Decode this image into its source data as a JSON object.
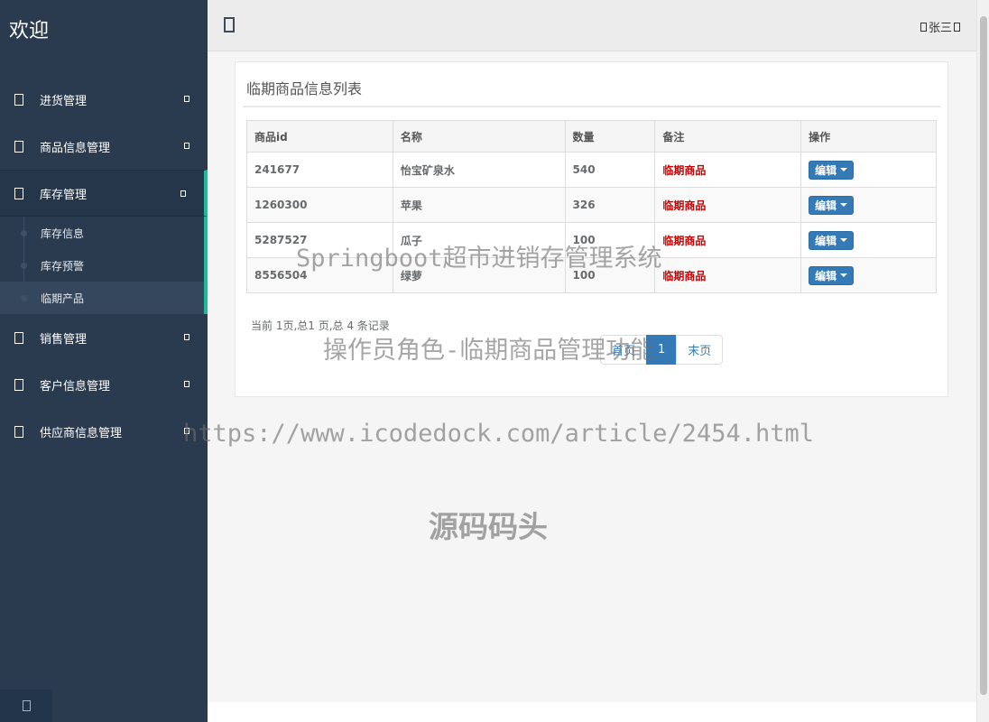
{
  "sidebar": {
    "brand": "欢迎",
    "menu": [
      {
        "label": "进货管理"
      },
      {
        "label": "商品信息管理"
      },
      {
        "label": "库存管理"
      },
      {
        "label": "销售管理"
      },
      {
        "label": "客户信息管理"
      },
      {
        "label": "供应商信息管理"
      }
    ],
    "submenu": [
      {
        "label": "库存信息"
      },
      {
        "label": "库存预警"
      },
      {
        "label": "临期产品"
      }
    ]
  },
  "topbar": {
    "user": "张三"
  },
  "panel": {
    "title": "临期商品信息列表",
    "columns": [
      "商品id",
      "名称",
      "数量",
      "备注",
      "操作"
    ],
    "rows": [
      {
        "id": "241677",
        "name": "怡宝矿泉水",
        "qty": "540",
        "note": "临期商品",
        "action": "编辑"
      },
      {
        "id": "1260300",
        "name": "苹果",
        "qty": "326",
        "note": "临期商品",
        "action": "编辑"
      },
      {
        "id": "5287527",
        "name": "瓜子",
        "qty": "100",
        "note": "临期商品",
        "action": "编辑"
      },
      {
        "id": "8556504",
        "name": "绿萝",
        "qty": "100",
        "note": "临期商品",
        "action": "编辑"
      }
    ],
    "page_info": "当前 1页,总1 页,总 4 条记录",
    "pager": {
      "first": "首页",
      "current": "1",
      "last": "末页"
    }
  },
  "watermarks": {
    "line1": "Springboot超市进销存管理系统",
    "line2": "操作员角色-临期商品管理功能",
    "line3": "https://www.icodedock.com/article/2454.html",
    "line4": "源码码头"
  },
  "colors": {
    "sidebar_bg": "#2a3b4f",
    "accent": "#1abc9c",
    "note_red": "#cc0000",
    "button_blue": "#337ab7"
  }
}
